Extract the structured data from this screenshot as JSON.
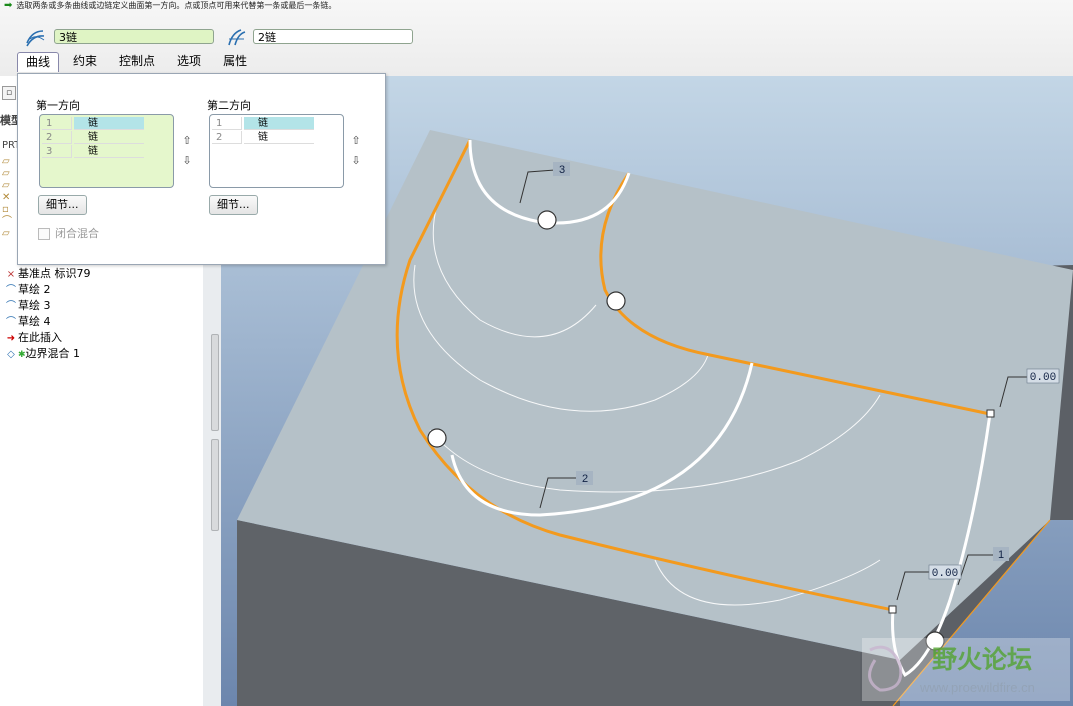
{
  "message": {
    "text": "选取两条或多条曲线或边链定义曲面第一方向。点或顶点可用来代替第一条或最后一条链。"
  },
  "dashboard": {
    "first_dir_icon": "boundary-first-direction-icon",
    "first_dir_value": "3链",
    "second_dir_icon": "boundary-second-direction-icon",
    "second_dir_value": "2链",
    "tabs": [
      {
        "label": "曲线",
        "active": true
      },
      {
        "label": "约束"
      },
      {
        "label": "控制点"
      },
      {
        "label": "选项"
      },
      {
        "label": "属性"
      }
    ]
  },
  "curves_panel": {
    "first_direction": {
      "title": "第一方向",
      "rows": [
        {
          "num": "1",
          "value": "链"
        },
        {
          "num": "2",
          "value": "链"
        },
        {
          "num": "3",
          "value": "链"
        }
      ],
      "details_button": "细节..."
    },
    "second_direction": {
      "title": "第二方向",
      "rows": [
        {
          "num": "1",
          "value": "链"
        },
        {
          "num": "2",
          "value": "链"
        }
      ],
      "details_button": "细节..."
    },
    "closed_blend_label": "闭合混合"
  },
  "model_tree": {
    "partial_header": "模型",
    "prt_label": "PRT",
    "items": [
      {
        "label": "基准点 标识79",
        "icon": "datum-point-icon"
      },
      {
        "label": "草绘 2",
        "icon": "sketch-icon"
      },
      {
        "label": "草绘 3",
        "icon": "sketch-icon"
      },
      {
        "label": "草绘 4",
        "icon": "sketch-icon"
      },
      {
        "label": "在此插入",
        "icon": "insert-here-arrow-icon"
      },
      {
        "label": "边界混合 1",
        "icon": "boundary-blend-icon"
      }
    ]
  },
  "viewport": {
    "labels": {
      "chain_3": "3",
      "chain_2": "2",
      "chain_1": "1",
      "value_a": "0.00",
      "value_b": "0.00"
    },
    "colors": {
      "background_top": "#c3d6e6",
      "background_bottom": "#6c86ad",
      "top_face": "#b5c1c8",
      "side_face": "#5f6368",
      "highlight": "#f39a1e",
      "curve": "#ffffff"
    }
  },
  "watermark": {
    "title": "野火论坛",
    "url": "www.proewildfire.cn"
  }
}
